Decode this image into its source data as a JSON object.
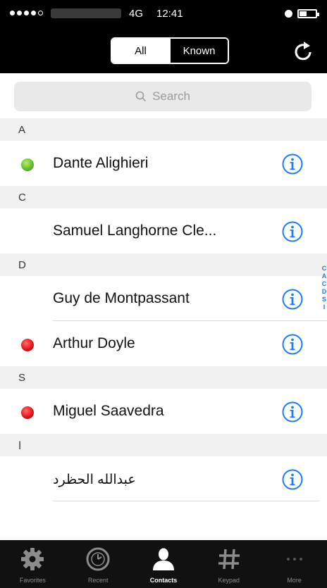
{
  "status_bar": {
    "network": "4G",
    "time": "12:41"
  },
  "filter": {
    "all_label": "All",
    "known_label": "Known",
    "selected": "All"
  },
  "search": {
    "placeholder": "Search"
  },
  "sections": [
    {
      "letter": "A",
      "contacts": [
        {
          "name": "Dante Alighieri",
          "presence": "online"
        }
      ]
    },
    {
      "letter": "C",
      "contacts": [
        {
          "name": "Samuel Langhorne Cle...",
          "presence": "none"
        }
      ]
    },
    {
      "letter": "D",
      "contacts": [
        {
          "name": "Guy de Montpassant",
          "presence": "none"
        },
        {
          "name": "Arthur Doyle",
          "presence": "busy"
        }
      ]
    },
    {
      "letter": "S",
      "contacts": [
        {
          "name": "Miguel Saavedra",
          "presence": "busy"
        }
      ]
    },
    {
      "letter": "ا",
      "contacts": [
        {
          "name": "عبدالله الحظرد",
          "presence": "none"
        }
      ]
    }
  ],
  "section_index": [
    "C",
    "A",
    "C",
    "D",
    "S",
    "I"
  ],
  "tabs": [
    {
      "label": "Favorites",
      "icon": "gear-icon",
      "selected": false
    },
    {
      "label": "Recent",
      "icon": "clock-icon",
      "selected": false
    },
    {
      "label": "Contacts",
      "icon": "person-icon",
      "selected": true
    },
    {
      "label": "Keypad",
      "icon": "hash-icon",
      "selected": false
    },
    {
      "label": "More",
      "icon": "ellipsis-icon",
      "selected": false
    }
  ],
  "colors": {
    "accent": "#1f7bf6",
    "online": "#5ab82a",
    "busy": "#e0101a",
    "bar_background": "#000000"
  }
}
